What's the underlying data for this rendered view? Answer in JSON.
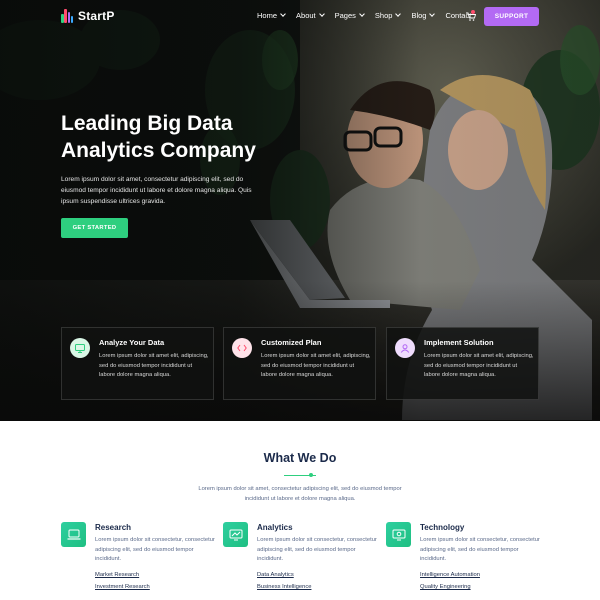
{
  "brand": {
    "name": "StartP",
    "colors": [
      "#2ecf7f",
      "#ff4d6d",
      "#b36af4",
      "#3ba9ff"
    ]
  },
  "nav": {
    "items": [
      {
        "label": "Home",
        "dropdown": true
      },
      {
        "label": "About",
        "dropdown": true
      },
      {
        "label": "Pages",
        "dropdown": true
      },
      {
        "label": "Shop",
        "dropdown": true
      },
      {
        "label": "Blog",
        "dropdown": true
      },
      {
        "label": "Contact",
        "dropdown": false
      }
    ],
    "cart_icon": "shopping-cart-icon",
    "support_label": "SUPPORT"
  },
  "hero": {
    "title": "Leading Big Data Analytics Company",
    "text": "Lorem ipsum dolor sit amet, consectetur adipiscing elit, sed do eiusmod tempor incididunt ut labore et dolore magna aliqua. Quis ipsum suspendisse ultrices gravida.",
    "cta_label": "GET STARTED"
  },
  "features": [
    {
      "title": "Analyze Your Data",
      "icon": "monitor-icon",
      "icon_bg": "#d9f7e6",
      "icon_color": "#2ecf7f",
      "text": "Lorem ipsum dolor sit amet elit, adipiscing, sed do eiusmod tempor incididunt ut labore dolore magna aliqua."
    },
    {
      "title": "Customized Plan",
      "icon": "code-icon",
      "icon_bg": "#ffe3ea",
      "icon_color": "#ff4d6d",
      "text": "Lorem ipsum dolor sit amet elit, adipiscing, sed do eiusmod tempor incididunt ut labore dolore magna aliqua."
    },
    {
      "title": "Implement Solution",
      "icon": "users-icon",
      "icon_bg": "#efdcfd",
      "icon_color": "#b36af4",
      "text": "Lorem ipsum dolor sit amet elit, adipiscing, sed do eiusmod tempor incididunt ut labore dolore magna aliqua."
    }
  ],
  "what_we_do": {
    "title": "What We Do",
    "text": "Lorem ipsum dolor sit amet, consectetur adipiscing elit, sed do eiusmod tempor incididunt ut labore et dolore magna aliqua.",
    "services": [
      {
        "title": "Research",
        "icon": "laptop-icon",
        "text": "Lorem ipsum dolor sit consectetur, consectetur adipiscing elit, sed do eiusmod tempor incididunt.",
        "links": [
          "Market Research",
          "Investment Research"
        ]
      },
      {
        "title": "Analytics",
        "icon": "chart-screen-icon",
        "text": "Lorem ipsum dolor sit consectetur, consectetur adipiscing elit, sed do eiusmod tempor incididunt.",
        "links": [
          "Data Analytics",
          "Business Intelligence"
        ]
      },
      {
        "title": "Technology",
        "icon": "gear-monitor-icon",
        "text": "Lorem ipsum dolor sit consectetur, consectetur adipiscing elit, sed do eiusmod tempor incididunt.",
        "links": [
          "Intelligence Automation",
          "Quality Engineering"
        ]
      }
    ]
  }
}
